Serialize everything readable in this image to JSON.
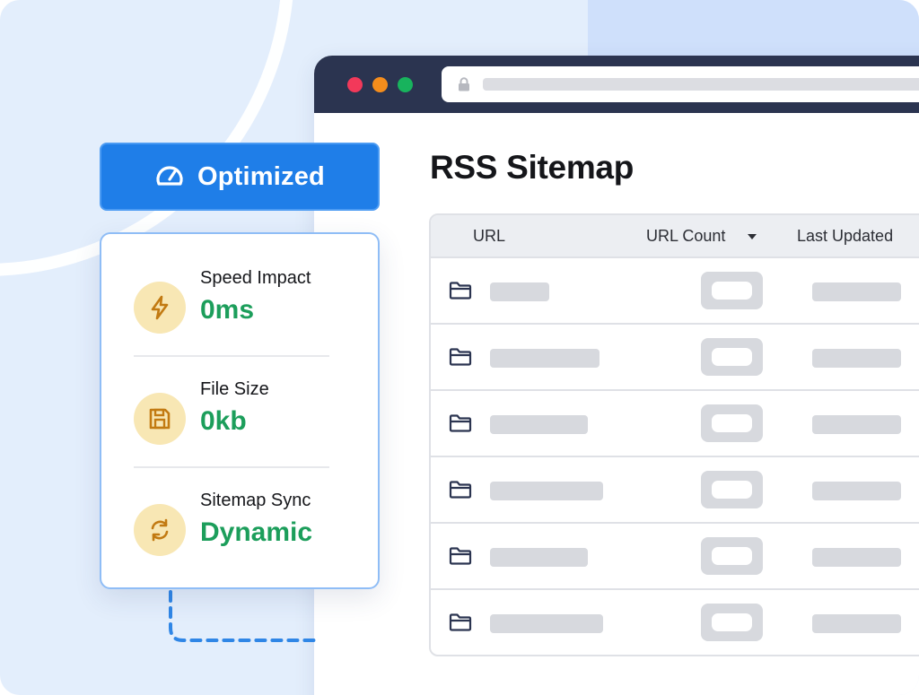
{
  "browser": {
    "window_controls": [
      "close",
      "minimize",
      "maximize"
    ],
    "address_icon": "lock-icon"
  },
  "page": {
    "title": "RSS Sitemap"
  },
  "table": {
    "columns": [
      "URL",
      "URL Count",
      "Last Updated"
    ],
    "sort_indicator": "caret-down-icon",
    "row_icon": "folder-icon",
    "row_count": 6
  },
  "badge": {
    "icon": "speedometer-icon",
    "label": "Optimized"
  },
  "metrics": [
    {
      "icon": "lightning-bolt-icon",
      "label": "Speed Impact",
      "value": "0ms"
    },
    {
      "icon": "floppy-disk-icon",
      "label": "File Size",
      "value": "0kb"
    },
    {
      "icon": "sync-arrows-icon",
      "label": "Sitemap Sync",
      "value": "Dynamic"
    }
  ],
  "colors": {
    "accent": "#1f7ee8",
    "success": "#1c9e5b",
    "chrome": "#2b3450",
    "icon_circle": "#f8e7b4",
    "icon_stroke": "#c27a12"
  }
}
